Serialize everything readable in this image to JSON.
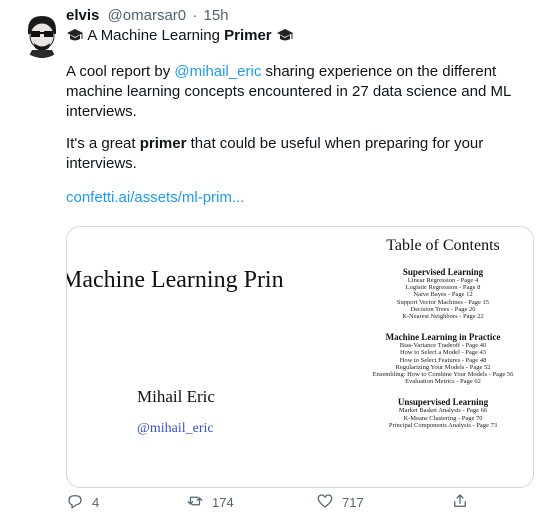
{
  "tweet": {
    "name": "elvis",
    "handle": "@omarsar0",
    "time": "15h",
    "line1_prefix": "A Machine Learning",
    "line1_bold": "Primer",
    "p1_before": "A cool report by ",
    "p1_mention": "@mihail_eric",
    "p1_after": " sharing experience on the different machine learning concepts encountered in 27 data science and ML interviews.",
    "p2_before": "It's a great ",
    "p2_bold": "primer",
    "p2_after": " that could be useful when preparing for your interviews.",
    "link": "confetti.ai/assets/ml-prim...",
    "colors": {
      "accent": "#1d9bf0",
      "muted": "#536471"
    }
  },
  "card": {
    "doc_title": "Machine Learning Prin",
    "author": "Mihail Eric",
    "author_handle": "@mihail_eric",
    "toc_title": "Table of Contents",
    "sections": [
      {
        "heading": "Supervised Learning",
        "items": [
          "Linear Regression - Page 4",
          "Logistic Regression - Page 8",
          "Naive Bayes - Page 12",
          "Support Vector Machines - Page 15",
          "Decision Trees - Page 20",
          "K-Nearest Neighbors - Page 22"
        ]
      },
      {
        "heading": "Machine Learning in Practice",
        "items": [
          "Bias-Variance Tradeoff - Page 40",
          "How to Select a Model - Page 43",
          "How to Select Features - Page 48",
          "Regularizing Your Models - Page 52",
          "Ensembling: How to Combine Your Models - Page 56",
          "Evaluation Metrics - Page 62"
        ]
      },
      {
        "heading": "Unsupervised Learning",
        "items": [
          "Market Basket Analysis - Page 66",
          "K-Means Clustering - Page 70",
          "Principal Components Analysis - Page 73"
        ]
      }
    ]
  },
  "actions": {
    "replies": "4",
    "retweets": "174",
    "likes": "717",
    "icons": [
      "reply-icon",
      "retweet-icon",
      "like-icon",
      "share-icon"
    ]
  }
}
